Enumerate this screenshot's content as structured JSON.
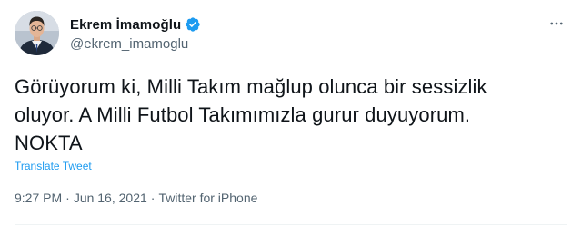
{
  "author": {
    "display_name": "Ekrem İmamoğlu",
    "handle": "@ekrem_imamoglu",
    "verified": true,
    "avatar_icon": "profile-photo"
  },
  "tweet": {
    "text": "Görüyorum ki, Milli Takım mağlup olunca bir sessizlik\noluyor. A Milli Futbol Takımımızla gurur duyuyorum.\nNOKTA",
    "translate_label": "Translate Tweet"
  },
  "meta": {
    "time": "9:27 PM",
    "separator": "·",
    "date": "Jun 16, 2021",
    "source": "Twitter for iPhone"
  },
  "colors": {
    "accent": "#1d9bf0",
    "text": "#0f1419",
    "secondary": "#536471"
  },
  "icons": {
    "verified": "verified-badge-icon",
    "more": "more-options-icon"
  }
}
